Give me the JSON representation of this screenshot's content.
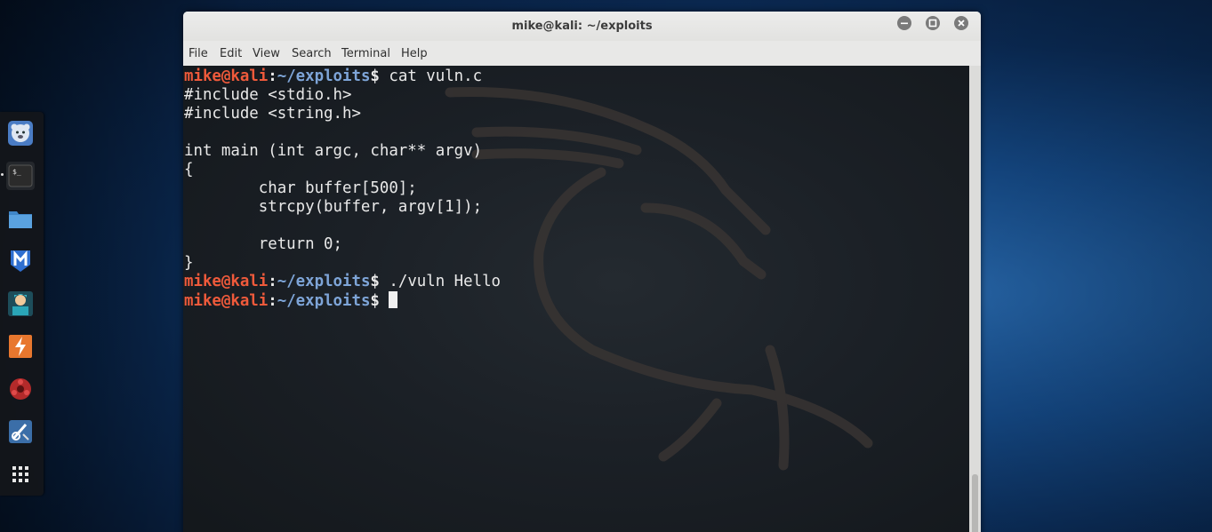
{
  "window": {
    "title": "mike@kali: ~/exploits",
    "controls": [
      "minimize",
      "maximize",
      "close"
    ]
  },
  "menu": {
    "items": [
      "File",
      "Edit",
      "View",
      "Search",
      "Terminal",
      "Help"
    ]
  },
  "prompt": {
    "user_host": "mike@kali",
    "colon": ":",
    "path": "~/exploits",
    "symbol": "$"
  },
  "terminal": {
    "lines": [
      {
        "type": "prompt",
        "command": " cat vuln.c"
      },
      {
        "type": "output",
        "text": "#include <stdio.h>"
      },
      {
        "type": "output",
        "text": "#include <string.h>"
      },
      {
        "type": "output",
        "text": ""
      },
      {
        "type": "output",
        "text": "int main (int argc, char** argv)"
      },
      {
        "type": "output",
        "text": "{"
      },
      {
        "type": "output",
        "text": "        char buffer[500];"
      },
      {
        "type": "output",
        "text": "        strcpy(buffer, argv[1]);"
      },
      {
        "type": "output",
        "text": ""
      },
      {
        "type": "output",
        "text": "        return 0;"
      },
      {
        "type": "output",
        "text": "}"
      },
      {
        "type": "prompt",
        "command": " ./vuln Hello"
      },
      {
        "type": "prompt",
        "command": " ",
        "cursor": true
      }
    ]
  },
  "dock": {
    "items": [
      {
        "name": "dock-item-system-monitor",
        "icon": "bear-icon"
      },
      {
        "name": "dock-item-terminal",
        "icon": "terminal-icon",
        "active": true
      },
      {
        "name": "dock-item-files",
        "icon": "folder-icon"
      },
      {
        "name": "dock-item-metasploit",
        "icon": "metasploit-icon"
      },
      {
        "name": "dock-item-armitage",
        "icon": "armitage-icon"
      },
      {
        "name": "dock-item-burpsuite",
        "icon": "burpsuite-icon"
      },
      {
        "name": "dock-item-maltego",
        "icon": "maltego-icon"
      },
      {
        "name": "dock-item-tools",
        "icon": "tools-icon"
      },
      {
        "name": "dock-item-show-apps",
        "icon": "apps-grid-icon"
      }
    ]
  },
  "colors": {
    "prompt_user": "#ef5a3b",
    "prompt_path": "#7ea5d8",
    "terminal_text": "#e9e9e9",
    "terminal_bg": "#1b2026"
  }
}
